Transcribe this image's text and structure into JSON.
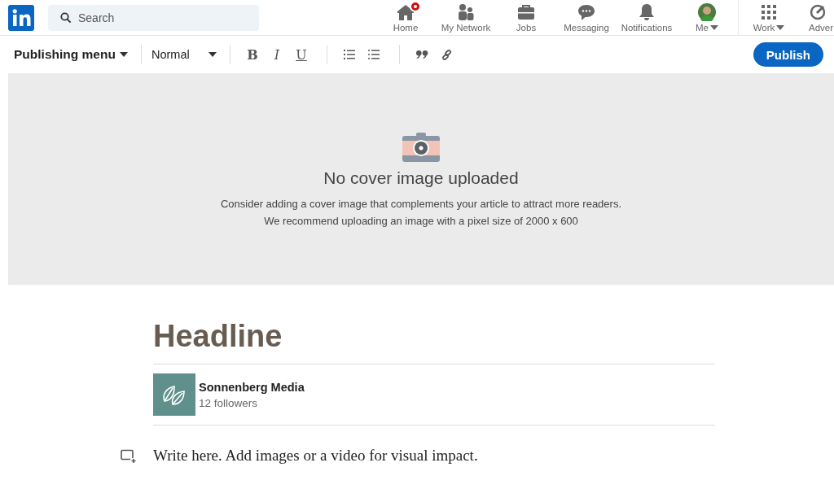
{
  "nav": {
    "search": {
      "placeholder": "Search"
    },
    "items": [
      {
        "kind": "home",
        "label": "Home",
        "badge": true,
        "caret": false
      },
      {
        "kind": "network",
        "label": "My Network",
        "badge": false,
        "caret": false
      },
      {
        "kind": "jobs",
        "label": "Jobs",
        "badge": false,
        "caret": false
      },
      {
        "kind": "messaging",
        "label": "Messaging",
        "badge": false,
        "caret": false
      },
      {
        "kind": "notifications",
        "label": "Notifications",
        "badge": false,
        "caret": false
      },
      {
        "kind": "avatar",
        "label": "Me",
        "badge": false,
        "caret": true
      }
    ],
    "extra_items": [
      {
        "kind": "grid",
        "label": "Work",
        "caret": true
      },
      {
        "kind": "advertise",
        "label": "Adver",
        "caret": false
      }
    ]
  },
  "toolbar": {
    "menu": "Publishing menu",
    "style": "Normal",
    "format_buttons": [
      {
        "kind": "bold",
        "label": "B"
      },
      {
        "kind": "italic",
        "label": "I"
      },
      {
        "kind": "underline",
        "label": "U"
      }
    ],
    "tool_icons": [
      {
        "kind": "ordered-list"
      },
      {
        "kind": "bullet-list"
      },
      {
        "kind": "quote"
      },
      {
        "kind": "link"
      }
    ],
    "publish": "Publish"
  },
  "cover": {
    "title": "No cover image uploaded",
    "lines": [
      "Consider adding a cover image that complements your article to attract more readers.",
      "We recommend uploading an image with a pixel size of 2000 x 600"
    ]
  },
  "article": {
    "headline_placeholder": "Headline",
    "author": {
      "name": "Sonnenberg Media",
      "followers": "12 followers"
    },
    "body_placeholder": "Write here. Add images or a video for visual impact."
  }
}
